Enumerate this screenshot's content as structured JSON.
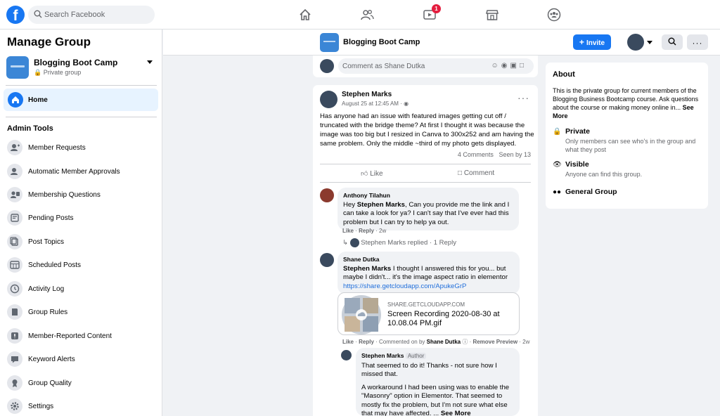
{
  "topbar": {
    "logo": "f",
    "search_placeholder": "Search Facebook",
    "watch_badge": "1",
    "icons": [
      "home-icon",
      "friends-icon",
      "watch-icon",
      "marketplace-icon",
      "groups-icon"
    ]
  },
  "sidebar": {
    "title": "Manage Group",
    "group_name": "Blogging Boot Camp",
    "group_privacy": "Private group",
    "home_label": "Home",
    "admin_heading": "Admin Tools",
    "items": [
      {
        "label": "Member Requests",
        "icon": "member-requests-icon"
      },
      {
        "label": "Automatic Member Approvals",
        "icon": "member-approvals-icon"
      },
      {
        "label": "Membership Questions",
        "icon": "membership-questions-icon"
      },
      {
        "label": "Pending Posts",
        "icon": "pending-posts-icon"
      },
      {
        "label": "Post Topics",
        "icon": "post-topics-icon"
      },
      {
        "label": "Scheduled Posts",
        "icon": "scheduled-posts-icon"
      },
      {
        "label": "Activity Log",
        "icon": "activity-log-icon"
      },
      {
        "label": "Group Rules",
        "icon": "group-rules-icon"
      },
      {
        "label": "Member-Reported Content",
        "icon": "reported-content-icon"
      },
      {
        "label": "Keyword Alerts",
        "icon": "keyword-alerts-icon"
      },
      {
        "label": "Group Quality",
        "icon": "group-quality-icon"
      },
      {
        "label": "Settings",
        "icon": "settings-icon"
      }
    ]
  },
  "group_header": {
    "name": "Blogging Boot Camp",
    "invite_label": "Invite"
  },
  "comment_box": {
    "placeholder": "Comment as Shane Dutka"
  },
  "post": {
    "author": "Stephen Marks",
    "time": "August 25 at 12:45 AM",
    "text": "Has anyone had an issue with featured images getting cut off / truncated with the bridge theme? At first I thought it was because the image was too big but I resized in Canva to 300x252 and am having the same problem. Only the middle ~third of my photo gets displayed.",
    "comments_count": "4 Comments",
    "seen_by": "Seen by 13",
    "like_label": "Like",
    "comment_label": "Comment"
  },
  "comments": [
    {
      "author": "Anthony Tilahun",
      "mention": "Stephen Marks",
      "text_before": "Hey ",
      "text_after": ", Can you provide me the link and I can take a look for ya? I can't say that I've ever had this problem but I can try to help ya out.",
      "meta_like": "Like",
      "meta_reply": "Reply",
      "meta_time": "2w",
      "replied_text": "Stephen Marks replied · 1 Reply"
    },
    {
      "author": "Shane Dutka",
      "mention": "Stephen Marks",
      "text_after": " I thought I answered this for you... but maybe I didn't... it's the image aspect ratio in elementor",
      "link": "https://share.getcloudapp.com/ApukeGrP",
      "preview_domain": "SHARE.GETCLOUDAPP.COM",
      "preview_title": "Screen Recording 2020-08-30 at 10.08.04 PM.gif",
      "meta_like": "Like",
      "meta_reply": "Reply",
      "meta_commented_on_by": "Commented on by",
      "meta_commenter": "Shane Dutka",
      "meta_remove": "Remove Preview",
      "meta_time": "2w"
    },
    {
      "author": "Stephen Marks",
      "author_tag": "Author",
      "text_1": "That seemed to do it! Thanks - not sure how I missed that.",
      "text_2": "A workaround I had been using was to enable the \"Masonry\" option in Elementor. That seemed to mostly fix the problem, but I'm not sure what else that may have affected. ...",
      "see_more": "See More"
    }
  ],
  "about": {
    "heading": "About",
    "description": "This is the private group for current members of the Blogging Business Bootcamp course. Ask questions about the course or making money online in...",
    "see_more": "See More",
    "private_title": "Private",
    "private_sub": "Only members can see who's in the group and what they post",
    "visible_title": "Visible",
    "visible_sub": "Anyone can find this group.",
    "general_title": "General Group"
  },
  "colors": {
    "brand": "#1877f2",
    "background": "#f0f2f5",
    "text_secondary": "#65676b",
    "badge": "#e41e3f"
  }
}
